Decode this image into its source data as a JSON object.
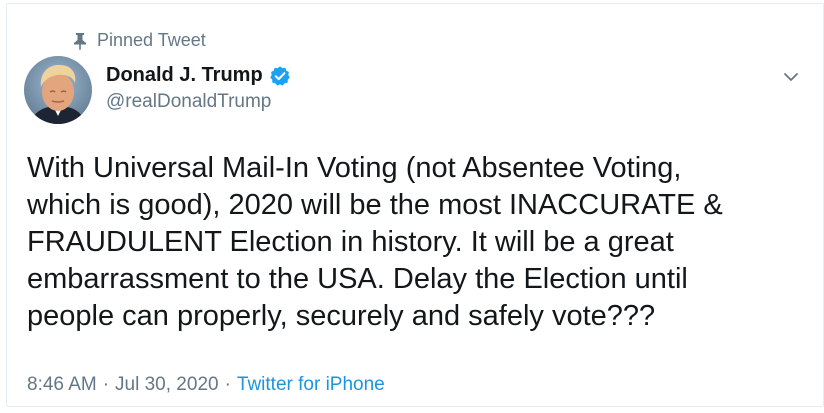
{
  "pinned": {
    "icon": "pin-icon",
    "label": "Pinned Tweet"
  },
  "author": {
    "name": "Donald J. Trump",
    "handle": "@realDonaldTrump",
    "verified": true,
    "verified_icon": "verified-badge-icon",
    "avatar_icon": "avatar-portrait"
  },
  "menu": {
    "icon": "chevron-down-icon"
  },
  "tweet": {
    "text": "With Universal Mail-In Voting (not Absentee Voting,\nwhich is good), 2020 will be the most INACCURATE &\nFRAUDULENT Election in history. It will be a great\nembarrassment to the USA. Delay the Election until\npeople can properly, securely and safely vote???"
  },
  "meta": {
    "time": "8:46 AM",
    "separator": "·",
    "date": "Jul 30, 2020",
    "source": "Twitter for iPhone"
  },
  "colors": {
    "primary_text": "#14171a",
    "secondary_text": "#657786",
    "link": "#1b95e0",
    "verified": "#1da1f2",
    "border": "#e6ecf0"
  }
}
